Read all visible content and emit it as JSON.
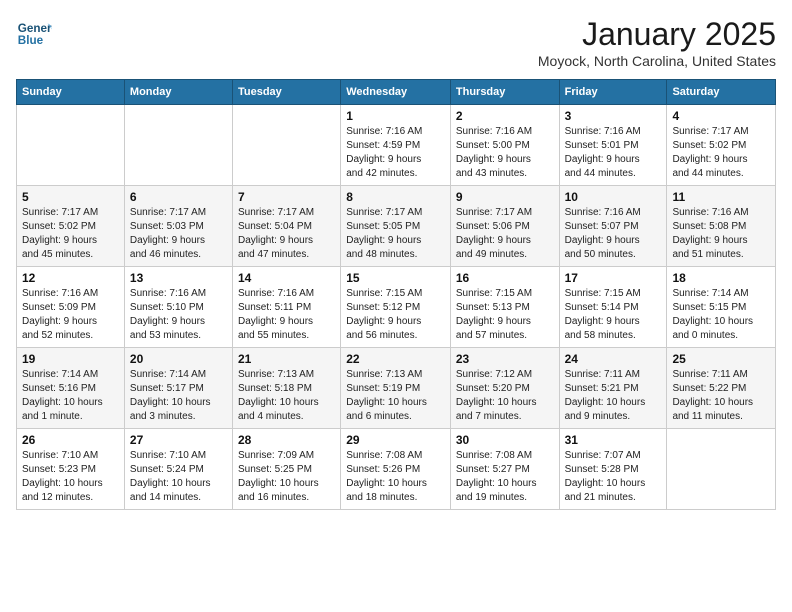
{
  "logo": {
    "line1": "General",
    "line2": "Blue"
  },
  "title": "January 2025",
  "subtitle": "Moyock, North Carolina, United States",
  "days_header": [
    "Sunday",
    "Monday",
    "Tuesday",
    "Wednesday",
    "Thursday",
    "Friday",
    "Saturday"
  ],
  "weeks": [
    [
      {
        "num": "",
        "info": ""
      },
      {
        "num": "",
        "info": ""
      },
      {
        "num": "",
        "info": ""
      },
      {
        "num": "1",
        "info": "Sunrise: 7:16 AM\nSunset: 4:59 PM\nDaylight: 9 hours\nand 42 minutes."
      },
      {
        "num": "2",
        "info": "Sunrise: 7:16 AM\nSunset: 5:00 PM\nDaylight: 9 hours\nand 43 minutes."
      },
      {
        "num": "3",
        "info": "Sunrise: 7:16 AM\nSunset: 5:01 PM\nDaylight: 9 hours\nand 44 minutes."
      },
      {
        "num": "4",
        "info": "Sunrise: 7:17 AM\nSunset: 5:02 PM\nDaylight: 9 hours\nand 44 minutes."
      }
    ],
    [
      {
        "num": "5",
        "info": "Sunrise: 7:17 AM\nSunset: 5:02 PM\nDaylight: 9 hours\nand 45 minutes."
      },
      {
        "num": "6",
        "info": "Sunrise: 7:17 AM\nSunset: 5:03 PM\nDaylight: 9 hours\nand 46 minutes."
      },
      {
        "num": "7",
        "info": "Sunrise: 7:17 AM\nSunset: 5:04 PM\nDaylight: 9 hours\nand 47 minutes."
      },
      {
        "num": "8",
        "info": "Sunrise: 7:17 AM\nSunset: 5:05 PM\nDaylight: 9 hours\nand 48 minutes."
      },
      {
        "num": "9",
        "info": "Sunrise: 7:17 AM\nSunset: 5:06 PM\nDaylight: 9 hours\nand 49 minutes."
      },
      {
        "num": "10",
        "info": "Sunrise: 7:16 AM\nSunset: 5:07 PM\nDaylight: 9 hours\nand 50 minutes."
      },
      {
        "num": "11",
        "info": "Sunrise: 7:16 AM\nSunset: 5:08 PM\nDaylight: 9 hours\nand 51 minutes."
      }
    ],
    [
      {
        "num": "12",
        "info": "Sunrise: 7:16 AM\nSunset: 5:09 PM\nDaylight: 9 hours\nand 52 minutes."
      },
      {
        "num": "13",
        "info": "Sunrise: 7:16 AM\nSunset: 5:10 PM\nDaylight: 9 hours\nand 53 minutes."
      },
      {
        "num": "14",
        "info": "Sunrise: 7:16 AM\nSunset: 5:11 PM\nDaylight: 9 hours\nand 55 minutes."
      },
      {
        "num": "15",
        "info": "Sunrise: 7:15 AM\nSunset: 5:12 PM\nDaylight: 9 hours\nand 56 minutes."
      },
      {
        "num": "16",
        "info": "Sunrise: 7:15 AM\nSunset: 5:13 PM\nDaylight: 9 hours\nand 57 minutes."
      },
      {
        "num": "17",
        "info": "Sunrise: 7:15 AM\nSunset: 5:14 PM\nDaylight: 9 hours\nand 58 minutes."
      },
      {
        "num": "18",
        "info": "Sunrise: 7:14 AM\nSunset: 5:15 PM\nDaylight: 10 hours\nand 0 minutes."
      }
    ],
    [
      {
        "num": "19",
        "info": "Sunrise: 7:14 AM\nSunset: 5:16 PM\nDaylight: 10 hours\nand 1 minute."
      },
      {
        "num": "20",
        "info": "Sunrise: 7:14 AM\nSunset: 5:17 PM\nDaylight: 10 hours\nand 3 minutes."
      },
      {
        "num": "21",
        "info": "Sunrise: 7:13 AM\nSunset: 5:18 PM\nDaylight: 10 hours\nand 4 minutes."
      },
      {
        "num": "22",
        "info": "Sunrise: 7:13 AM\nSunset: 5:19 PM\nDaylight: 10 hours\nand 6 minutes."
      },
      {
        "num": "23",
        "info": "Sunrise: 7:12 AM\nSunset: 5:20 PM\nDaylight: 10 hours\nand 7 minutes."
      },
      {
        "num": "24",
        "info": "Sunrise: 7:11 AM\nSunset: 5:21 PM\nDaylight: 10 hours\nand 9 minutes."
      },
      {
        "num": "25",
        "info": "Sunrise: 7:11 AM\nSunset: 5:22 PM\nDaylight: 10 hours\nand 11 minutes."
      }
    ],
    [
      {
        "num": "26",
        "info": "Sunrise: 7:10 AM\nSunset: 5:23 PM\nDaylight: 10 hours\nand 12 minutes."
      },
      {
        "num": "27",
        "info": "Sunrise: 7:10 AM\nSunset: 5:24 PM\nDaylight: 10 hours\nand 14 minutes."
      },
      {
        "num": "28",
        "info": "Sunrise: 7:09 AM\nSunset: 5:25 PM\nDaylight: 10 hours\nand 16 minutes."
      },
      {
        "num": "29",
        "info": "Sunrise: 7:08 AM\nSunset: 5:26 PM\nDaylight: 10 hours\nand 18 minutes."
      },
      {
        "num": "30",
        "info": "Sunrise: 7:08 AM\nSunset: 5:27 PM\nDaylight: 10 hours\nand 19 minutes."
      },
      {
        "num": "31",
        "info": "Sunrise: 7:07 AM\nSunset: 5:28 PM\nDaylight: 10 hours\nand 21 minutes."
      },
      {
        "num": "",
        "info": ""
      }
    ]
  ]
}
